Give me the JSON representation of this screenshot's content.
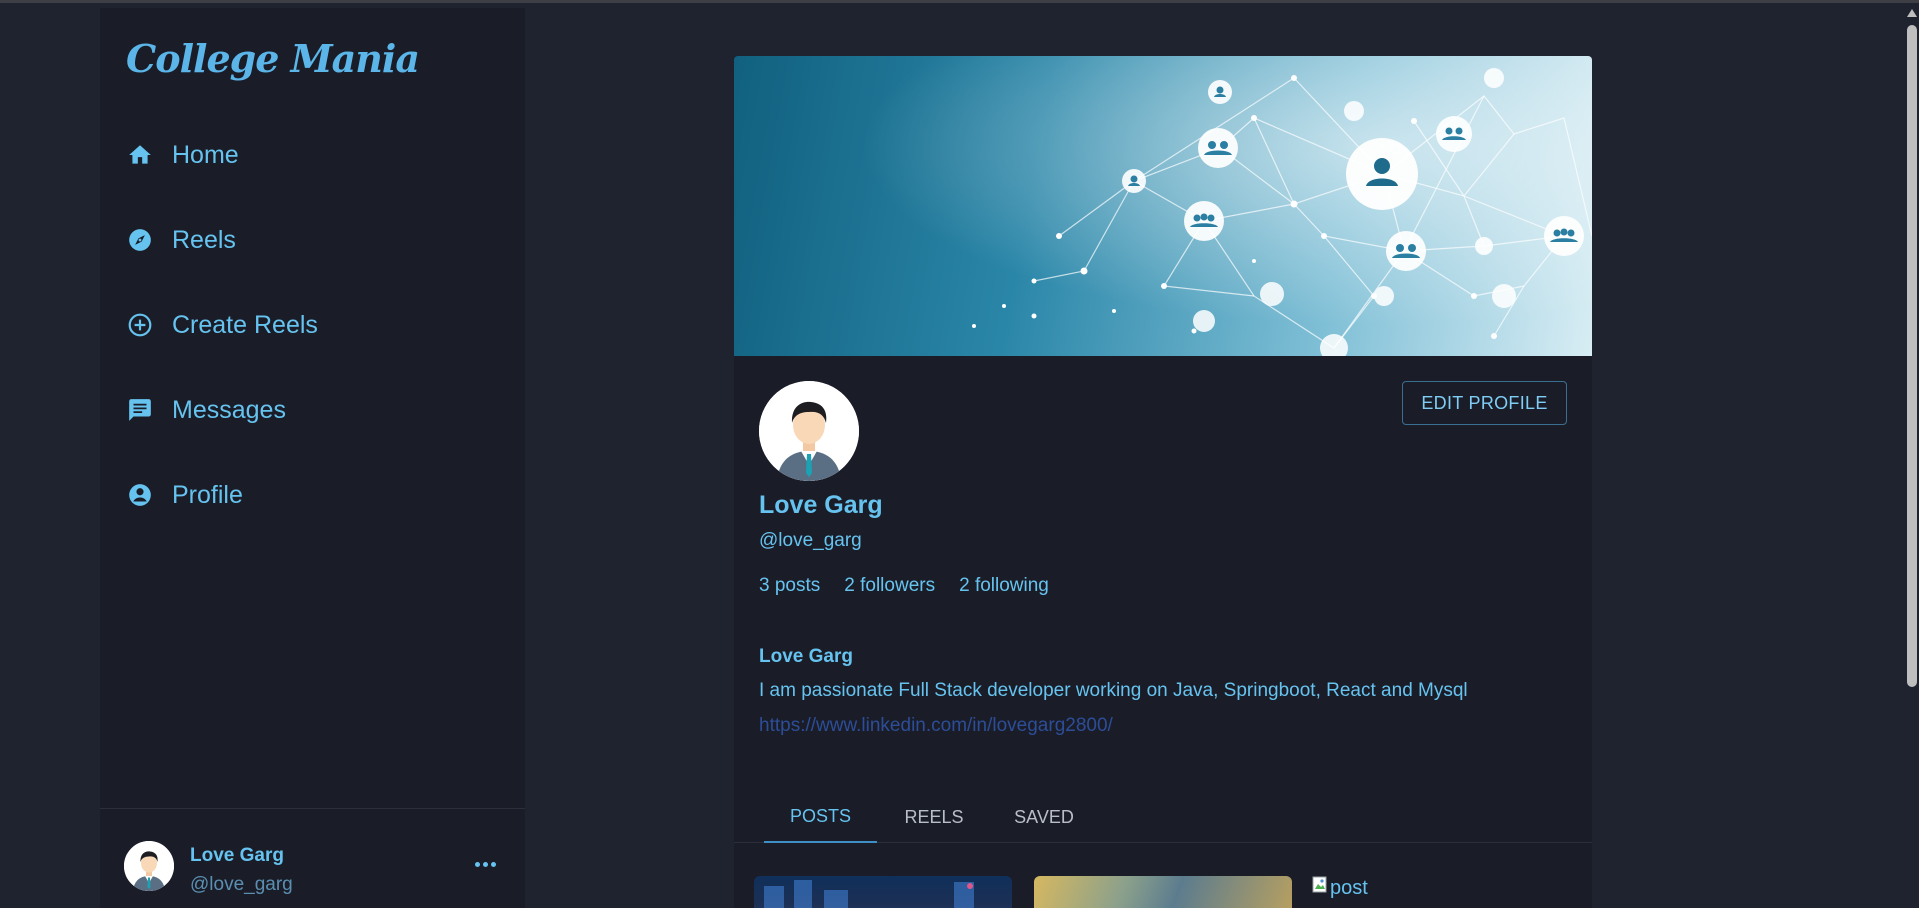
{
  "sidebar": {
    "logo": "College Mania",
    "items": [
      {
        "label": "Home",
        "icon": "home-icon"
      },
      {
        "label": "Reels",
        "icon": "explore-icon"
      },
      {
        "label": "Create Reels",
        "icon": "add-circle-icon"
      },
      {
        "label": "Messages",
        "icon": "message-icon"
      },
      {
        "label": "Profile",
        "icon": "account-circle-icon"
      }
    ],
    "footer": {
      "name": "Love Garg",
      "handle": "@love_garg",
      "more_icon": "more-horiz-icon"
    }
  },
  "profile": {
    "edit_button": "EDIT PROFILE",
    "name": "Love Garg",
    "handle": "@love_garg",
    "stats": {
      "posts": "3 posts",
      "followers": "2 followers",
      "following": "2 following"
    },
    "bio": {
      "name": "Love Garg",
      "text": "I am passionate Full Stack developer working on Java, Springboot, React and Mysql",
      "link": "https://www.linkedin.com/in/lovegarg2800/"
    }
  },
  "tabs": [
    {
      "label": "POSTS",
      "active": true
    },
    {
      "label": "REELS",
      "active": false
    },
    {
      "label": "SAVED",
      "active": false
    }
  ],
  "posts": {
    "broken_alt": "post"
  },
  "colors": {
    "accent": "#66c3ef",
    "background": "#1f2330",
    "panel": "#1a1d28",
    "link": "#2c4d97"
  }
}
